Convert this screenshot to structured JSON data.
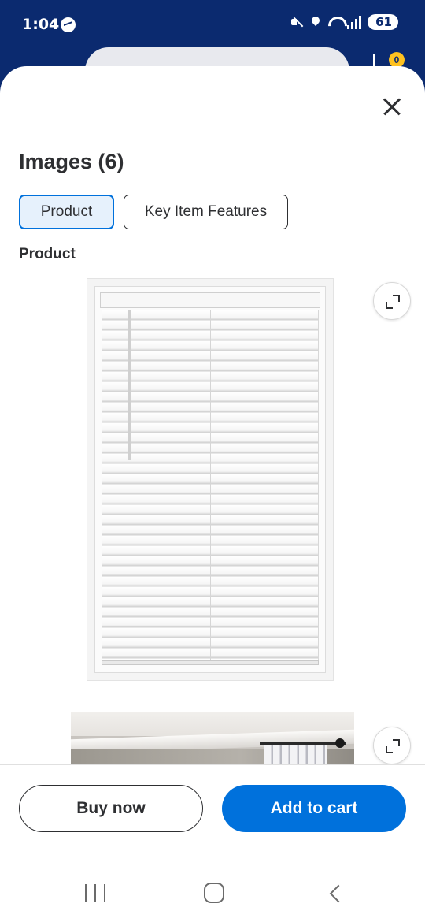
{
  "status_bar": {
    "time": "1:04",
    "battery": "61",
    "icons": [
      "messenger-icon",
      "mute-icon",
      "location-icon",
      "wifi-icon",
      "signal-icon",
      "battery-icon"
    ]
  },
  "background": {
    "cart_count": "0"
  },
  "sheet": {
    "title": "Images (6)",
    "tabs": [
      {
        "label": "Product",
        "selected": true
      },
      {
        "label": "Key Item Features",
        "selected": false
      }
    ],
    "section_label": "Product",
    "images": [
      {
        "name": "white-faux-wood-blind-image"
      },
      {
        "name": "room-with-curtain-rod-image"
      }
    ]
  },
  "actions": {
    "buy_now": "Buy now",
    "add_to_cart": "Add to cart"
  },
  "colors": {
    "brand_blue": "#0071dc",
    "status_bar_bg": "#0b2a6f",
    "text": "#2e2f32",
    "selected_tab_bg": "#e6f1fc"
  }
}
